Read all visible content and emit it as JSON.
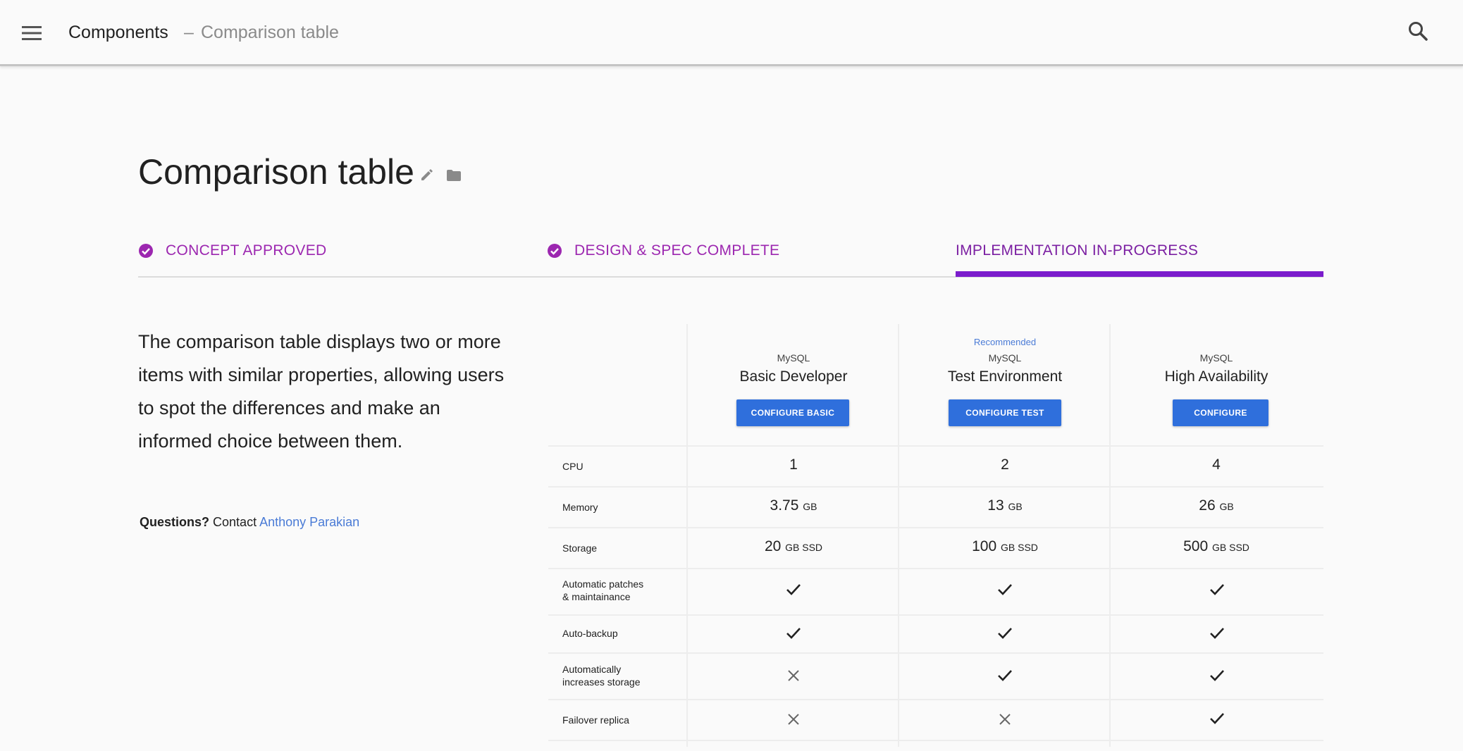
{
  "header": {
    "breadcrumb_root": "Components",
    "breadcrumb_sep": "–",
    "breadcrumb_current": "Comparison table"
  },
  "page": {
    "title": "Comparison table"
  },
  "stages": [
    {
      "label": "CONCEPT APPROVED",
      "complete": true
    },
    {
      "label": "DESIGN & SPEC COMPLETE",
      "complete": true
    },
    {
      "label": "IMPLEMENTATION IN-PROGRESS",
      "active": true
    }
  ],
  "intro": {
    "description": "The comparison table displays two or more items with similar properties, allowing users to spot the differences and make an informed choice between them.",
    "questions_label": "Questions?",
    "contact_text": "Contact",
    "contact_name": "Anthony Parakian"
  },
  "table": {
    "columns": [
      {
        "recommended": "",
        "category": "MySQL",
        "name": "Basic Developer",
        "button": "CONFIGURE BASIC"
      },
      {
        "recommended": "Recommended",
        "category": "MySQL",
        "name": "Test Environment",
        "button": "CONFIGURE TEST"
      },
      {
        "recommended": "",
        "category": "MySQL",
        "name": "High Availability",
        "button": "CONFIGURE"
      }
    ],
    "rows": [
      {
        "label": "CPU",
        "cells": [
          {
            "v": "1",
            "u": ""
          },
          {
            "v": "2",
            "u": ""
          },
          {
            "v": "4",
            "u": ""
          }
        ]
      },
      {
        "label": "Memory",
        "cells": [
          {
            "v": "3.75",
            "u": "GB"
          },
          {
            "v": "13",
            "u": "GB"
          },
          {
            "v": "26",
            "u": "GB"
          }
        ]
      },
      {
        "label": "Storage",
        "cells": [
          {
            "v": "20",
            "u": "GB SSD"
          },
          {
            "v": "100",
            "u": "GB SSD"
          },
          {
            "v": "500",
            "u": "GB SSD"
          }
        ]
      },
      {
        "label_1": "Automatic patches",
        "label_2": "& maintainance",
        "cells": [
          true,
          true,
          true
        ]
      },
      {
        "label": "Auto-backup",
        "cells": [
          true,
          true,
          true
        ]
      },
      {
        "label_1": "Automatically",
        "label_2": "increases storage",
        "cells": [
          false,
          true,
          true
        ]
      },
      {
        "label": "Failover replica",
        "cells": [
          false,
          false,
          true
        ]
      }
    ]
  },
  "colors": {
    "accent": "#9c27b0",
    "active_stage": "#7b1ccc",
    "button": "#2f6fdc",
    "link": "#4a7bd6"
  },
  "icons": {
    "menu": "hamburger-menu-icon",
    "search": "search-icon",
    "edit": "pencil-icon",
    "folder": "folder-icon",
    "check": "check-icon",
    "cross": "x-icon",
    "stage_done": "check-circle-icon"
  }
}
